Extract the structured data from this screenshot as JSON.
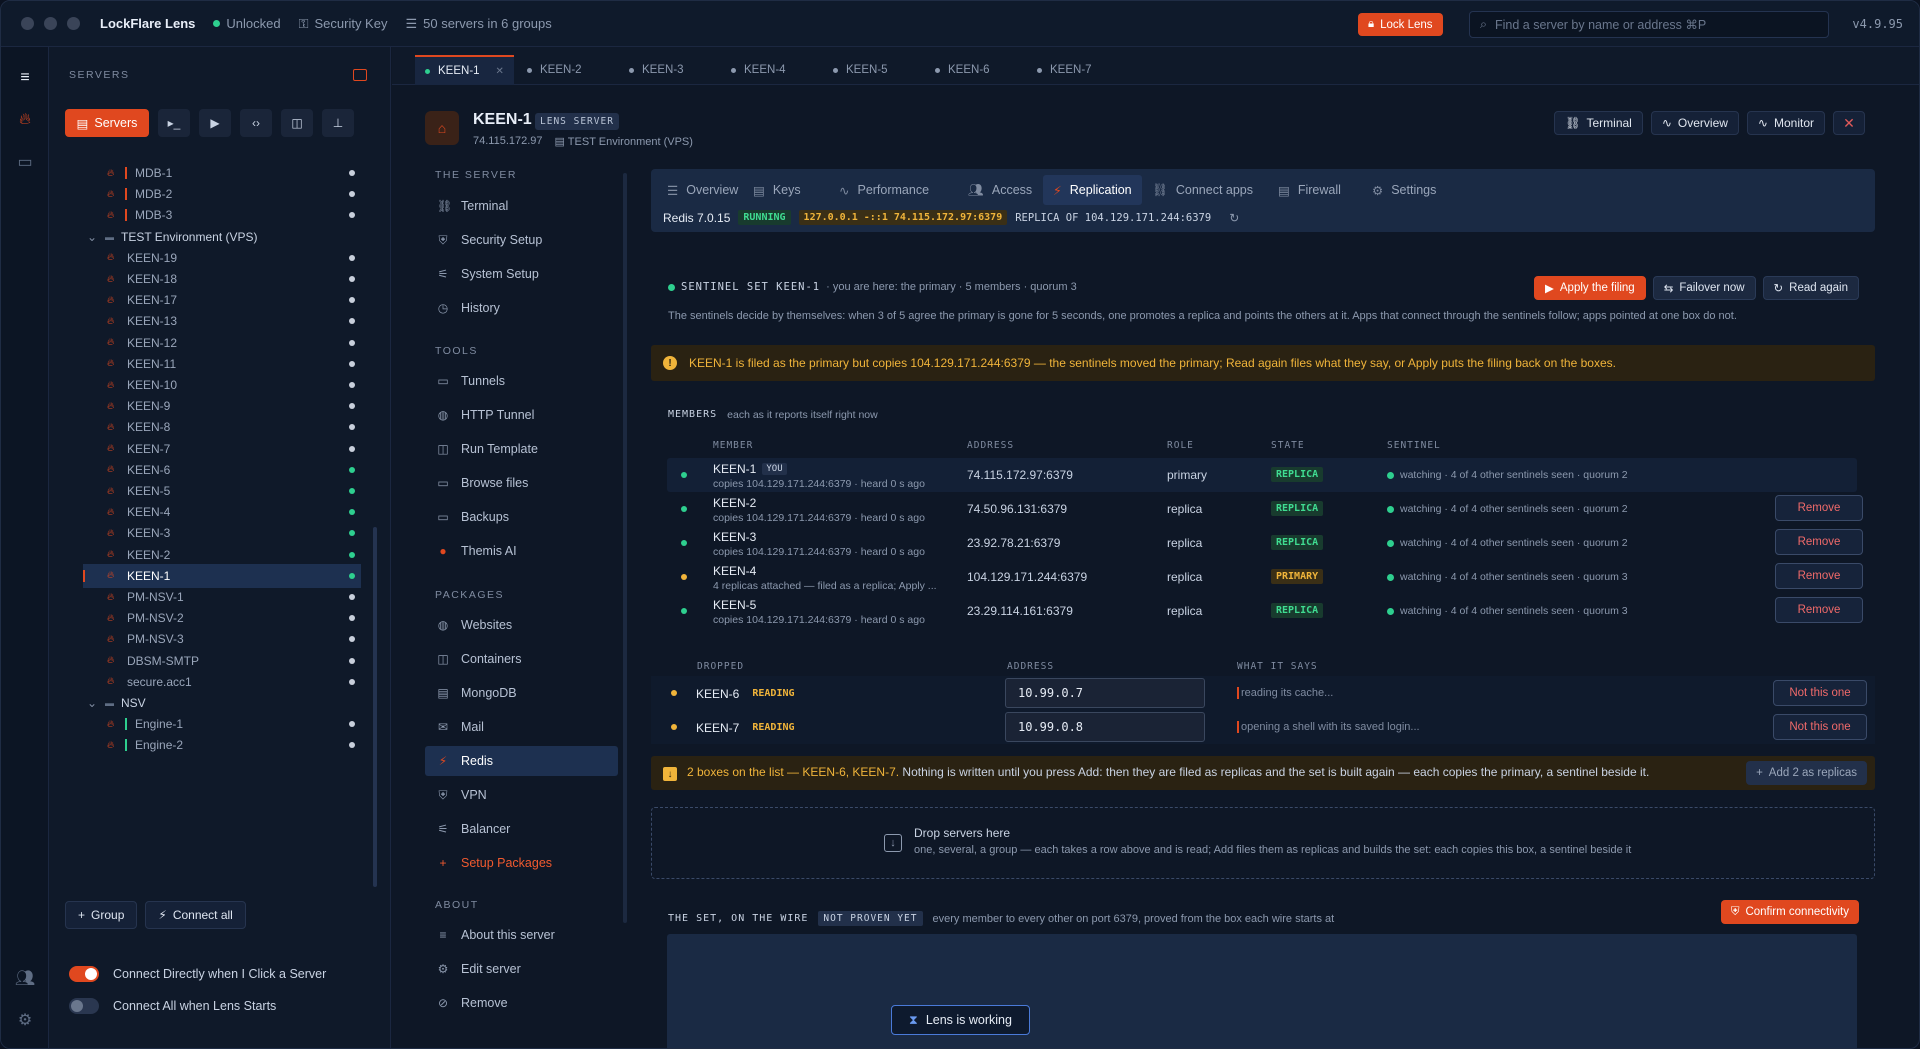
{
  "titlebar": {
    "app": "LockFlare Lens",
    "status": "Unlocked",
    "security_key": "Security Key",
    "servers_count": "50 servers in 6 groups",
    "lock_label": "Lock Lens",
    "search_placeholder": "Find a server by name or address  ⌘P",
    "version": "v4.9.95"
  },
  "sidebar": {
    "header": "SERVERS",
    "primary_label": "Servers",
    "items": [
      {
        "label": "MDB-1",
        "color": "#e0481f",
        "kind": "server"
      },
      {
        "label": "MDB-2",
        "color": "#e0481f",
        "kind": "server"
      },
      {
        "label": "MDB-3",
        "color": "#e0481f",
        "kind": "server"
      },
      {
        "label": "TEST Environment (VPS)",
        "kind": "group"
      },
      {
        "label": "KEEN-19",
        "kind": "server"
      },
      {
        "label": "KEEN-18",
        "kind": "server"
      },
      {
        "label": "KEEN-17",
        "kind": "server"
      },
      {
        "label": "KEEN-13",
        "kind": "server"
      },
      {
        "label": "KEEN-12",
        "kind": "server"
      },
      {
        "label": "KEEN-11",
        "kind": "server"
      },
      {
        "label": "KEEN-10",
        "kind": "server"
      },
      {
        "label": "KEEN-9",
        "kind": "server"
      },
      {
        "label": "KEEN-8",
        "kind": "server"
      },
      {
        "label": "KEEN-7",
        "kind": "server"
      },
      {
        "label": "KEEN-6",
        "kind": "server",
        "online": true
      },
      {
        "label": "KEEN-5",
        "kind": "server",
        "online": true
      },
      {
        "label": "KEEN-4",
        "kind": "server",
        "online": true
      },
      {
        "label": "KEEN-3",
        "kind": "server",
        "online": true
      },
      {
        "label": "KEEN-2",
        "kind": "server",
        "online": true
      },
      {
        "label": "KEEN-1",
        "kind": "server",
        "online": true,
        "selected": true
      },
      {
        "label": "PM-NSV-1",
        "kind": "server"
      },
      {
        "label": "PM-NSV-2",
        "kind": "server"
      },
      {
        "label": "PM-NSV-3",
        "kind": "server"
      },
      {
        "label": "DBSM-SMTP",
        "kind": "server"
      },
      {
        "label": "secure.acc1",
        "kind": "server"
      },
      {
        "label": "NSV",
        "kind": "group"
      },
      {
        "label": "Engine-1",
        "color": "#2ecf8f",
        "kind": "server"
      },
      {
        "label": "Engine-2",
        "color": "#2ecf8f",
        "kind": "server"
      }
    ],
    "group_btn": "Group",
    "connect_all_btn": "Connect all",
    "toggle1": "Connect Directly when I Click a Server",
    "toggle2": "Connect All when Lens Starts"
  },
  "tabs": [
    "KEEN-1",
    "KEEN-2",
    "KEEN-3",
    "KEEN-4",
    "KEEN-5",
    "KEEN-6",
    "KEEN-7"
  ],
  "server": {
    "name": "KEEN-1",
    "badge": "LENS SERVER",
    "address": "74.115.172.97",
    "env": "TEST Environment (VPS)",
    "btn_terminal": "Terminal",
    "btn_overview": "Overview",
    "btn_monitor": "Monitor",
    "btn_close": "✕"
  },
  "nav": {
    "h_server": "THE SERVER",
    "h_tools": "TOOLS",
    "h_packages": "PACKAGES",
    "h_about": "ABOUT",
    "server_items": [
      "Terminal",
      "Security Setup",
      "System Setup",
      "History"
    ],
    "tool_items": [
      "Tunnels",
      "HTTP Tunnel",
      "Run Template",
      "Browse files",
      "Backups",
      "Themis AI"
    ],
    "package_items": [
      "Websites",
      "Containers",
      "MongoDB",
      "Mail",
      "Redis",
      "VPN",
      "Balancer",
      "Setup Packages"
    ],
    "about_items": [
      "About this server",
      "Edit server",
      "Remove"
    ]
  },
  "subtabs": [
    "Overview",
    "Keys",
    "Performance",
    "Access",
    "Replication",
    "Connect apps",
    "Firewall",
    "Settings"
  ],
  "redis": {
    "version": "Redis 7.0.15",
    "status": "RUNNING",
    "bind": "127.0.0.1 -::1 74.115.172.97:6379",
    "replica_of": "REPLICA OF 104.129.171.244:6379"
  },
  "sentinel": {
    "title": "SENTINEL SET KEEN-1",
    "meta": "· you are here: the primary · 5 members · quorum 3",
    "desc": "The sentinels decide by themselves: when 3 of 5 agree the primary is gone for 5 seconds, one promotes a replica and points the others at it. Apps that connect through the sentinels follow; apps pointed at one box do not.",
    "btn_apply": "Apply the filing",
    "btn_failover": "Failover now",
    "btn_read": "Read again",
    "warning": "KEEN-1 is filed as the primary but copies 104.129.171.244:6379 — the sentinels moved the primary; Read again files what they say, or Apply puts the filing back on the boxes."
  },
  "members": {
    "title": "MEMBERS",
    "subtitle": "each as it reports itself right now",
    "cols": [
      "MEMBER",
      "ADDRESS",
      "ROLE",
      "STATE",
      "SENTINEL"
    ],
    "rows": [
      {
        "name": "KEEN-1",
        "you": "YOU",
        "sub": "copies 104.129.171.244:6379 · heard 0 s ago",
        "addr": "74.115.172.97:6379",
        "role": "primary",
        "state": "REPLICA",
        "sentinel": "watching · 4 of 4 other sentinels seen · quorum 2",
        "dot": "#2ecf8f"
      },
      {
        "name": "KEEN-2",
        "sub": "copies 104.129.171.244:6379 · heard 0 s ago",
        "addr": "74.50.96.131:6379",
        "role": "replica",
        "state": "REPLICA",
        "sentinel": "watching · 4 of 4 other sentinels seen · quorum 2",
        "dot": "#2ecf8f",
        "remove": "Remove"
      },
      {
        "name": "KEEN-3",
        "sub": "copies 104.129.171.244:6379 · heard 0 s ago",
        "addr": "23.92.78.21:6379",
        "role": "replica",
        "state": "REPLICA",
        "sentinel": "watching · 4 of 4 other sentinels seen · quorum 2",
        "dot": "#2ecf8f",
        "remove": "Remove"
      },
      {
        "name": "KEEN-4",
        "sub": "4 replicas attached — filed as a replica; Apply ...",
        "addr": "104.129.171.244:6379",
        "role": "replica",
        "state": "PRIMARY",
        "sentinel": "watching · 4 of 4 other sentinels seen · quorum 3",
        "dot": "#f0b43a",
        "remove": "Remove"
      },
      {
        "name": "KEEN-5",
        "sub": "copies 104.129.171.244:6379 · heard 0 s ago",
        "addr": "23.29.114.161:6379",
        "role": "replica",
        "state": "REPLICA",
        "sentinel": "watching · 4 of 4 other sentinels seen · quorum 3",
        "dot": "#2ecf8f",
        "remove": "Remove"
      }
    ]
  },
  "dropped": {
    "cols": [
      "DROPPED",
      "ADDRESS",
      "WHAT IT SAYS"
    ],
    "rows": [
      {
        "name": "KEEN-6",
        "state": "READING",
        "addr": "10.99.0.7",
        "says": "reading its cache...",
        "btn": "Not this one"
      },
      {
        "name": "KEEN-7",
        "state": "READING",
        "addr": "10.99.0.8",
        "says": "opening a shell with its saved login...",
        "btn": "Not this one"
      }
    ]
  },
  "note": {
    "lead": "2 boxes on the list — KEEN-6, KEEN-7.",
    "rest": " Nothing is written until you press Add: then they are filed as replicas and the set is built again — each copies the primary, a sentinel beside it.",
    "btn": "Add 2 as replicas"
  },
  "dropzone": {
    "title": "Drop servers here",
    "sub": "one, several, a group — each takes a row above and is read; Add files them as replicas and builds the set: each copies this box, a sentinel beside it"
  },
  "wire": {
    "title": "THE SET, ON THE WIRE",
    "badge": "NOT PROVEN YET",
    "desc": "every member to every other on port 6379, proved from the box each wire starts at",
    "btn": "Confirm connectivity"
  },
  "toast": "Lens is working"
}
